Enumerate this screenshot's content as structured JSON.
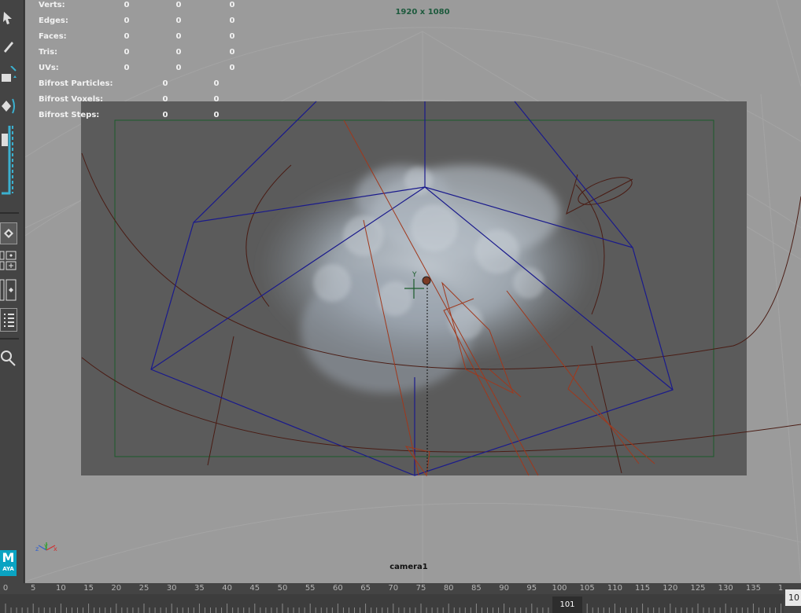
{
  "hud": {
    "rows": [
      {
        "label": "Verts:",
        "v1": "0",
        "v2": "0",
        "v3": "0"
      },
      {
        "label": "Edges:",
        "v1": "0",
        "v2": "0",
        "v3": "0"
      },
      {
        "label": "Faces:",
        "v1": "0",
        "v2": "0",
        "v3": "0"
      },
      {
        "label": "Tris:",
        "v1": "0",
        "v2": "0",
        "v3": "0"
      },
      {
        "label": "UVs:",
        "v1": "0",
        "v2": "0",
        "v3": "0"
      }
    ],
    "bifrost_rows": [
      {
        "label": "Bifrost Particles:",
        "v1": "0",
        "v2": "0"
      },
      {
        "label": "Bifrost Voxels:",
        "v1": "0",
        "v2": "0"
      },
      {
        "label": "Bifrost Steps:",
        "v1": "0",
        "v2": "0"
      }
    ]
  },
  "viewport": {
    "resolution": "1920 x 1080",
    "camera": "camera1",
    "locator_label": "Y",
    "axis_labels": {
      "z": "z",
      "y": "y",
      "x": "x"
    }
  },
  "timeslider": {
    "ticks": [
      "0",
      "5",
      "10",
      "15",
      "20",
      "25",
      "30",
      "35",
      "40",
      "45",
      "50",
      "55",
      "60",
      "65",
      "70",
      "75",
      "80",
      "85",
      "90",
      "95",
      "100",
      "105",
      "110",
      "115",
      "120",
      "125",
      "130",
      "135",
      "1"
    ],
    "current_frame": "101",
    "end_field": "10"
  },
  "logo": {
    "letter": "M",
    "sub": "AYA"
  },
  "icons": [
    "select-tool-icon",
    "lasso-tool-icon",
    "paint-select-icon",
    "move-tool-icon",
    "rotate-tool-icon",
    "scale-tool-icon",
    "layout-single-icon",
    "layout-four-icon",
    "layout-two-icon",
    "outliner-icon",
    "search-icon"
  ],
  "colors": {
    "viewport_bg": "#9b9b9b",
    "gate_bg": "#5b5b5b",
    "frustum": "#1a1a8c",
    "red_lines": "#a0381c",
    "brown_curve": "#4a1c14",
    "resolution_gate": "#1b5b2b",
    "accent": "#3bb0cf"
  }
}
